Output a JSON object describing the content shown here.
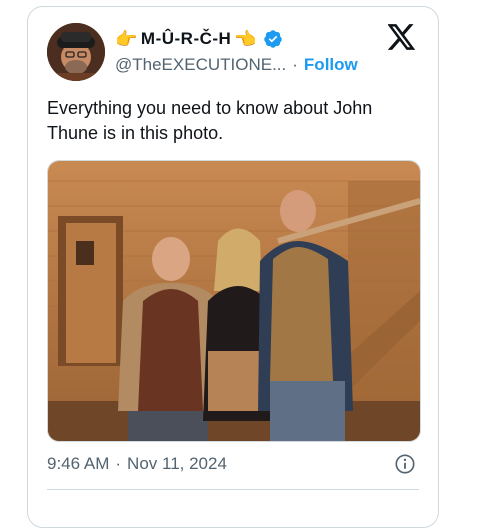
{
  "tweet": {
    "display_name": "M-Û-R-Č-H",
    "name_emoji_left": "👉",
    "name_emoji_right": "👈",
    "handle": "@TheEXECUTIONE...",
    "separator": "·",
    "follow_label": "Follow",
    "text": "Everything you need to know about John Thune is in this photo.",
    "time": "9:46 AM",
    "date": "Nov 11, 2024",
    "meta_separator": "·"
  },
  "colors": {
    "accent": "#1d9bf0",
    "secondary_text": "#536471",
    "border": "#cfd9de"
  },
  "icons": {
    "verified": "verified-badge-icon",
    "platform": "x-logo-icon",
    "info": "info-icon"
  }
}
